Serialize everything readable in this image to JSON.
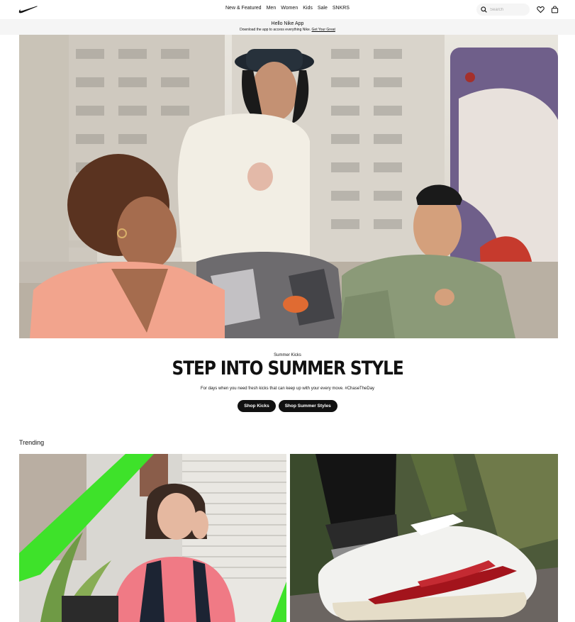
{
  "header": {
    "logo": "nike-swoosh",
    "nav": [
      "New & Featured",
      "Men",
      "Women",
      "Kids",
      "Sale",
      "SNKRS"
    ],
    "search_placeholder": "Search",
    "icons": [
      "search-icon",
      "heart-icon",
      "bag-icon"
    ]
  },
  "banner": {
    "title": "Hello Nike App",
    "subtitle": "Download the app to access everything Nike.",
    "link": "Get Your Great"
  },
  "hero": {
    "eyebrow": "Summer Kicks",
    "headline": "STEP INTO SUMMER STYLE",
    "subcopy": "For days when you need fresh kicks that can keep up with your every move. #ChaseTheDay",
    "buttons": [
      "Shop Kicks",
      "Shop Summer Styles"
    ]
  },
  "trending": {
    "title": "Trending"
  },
  "colors": {
    "black": "#111111",
    "banner_bg": "#f5f5f5",
    "accent_green": "#3ee22a",
    "shoe_red": "#a3141c"
  }
}
